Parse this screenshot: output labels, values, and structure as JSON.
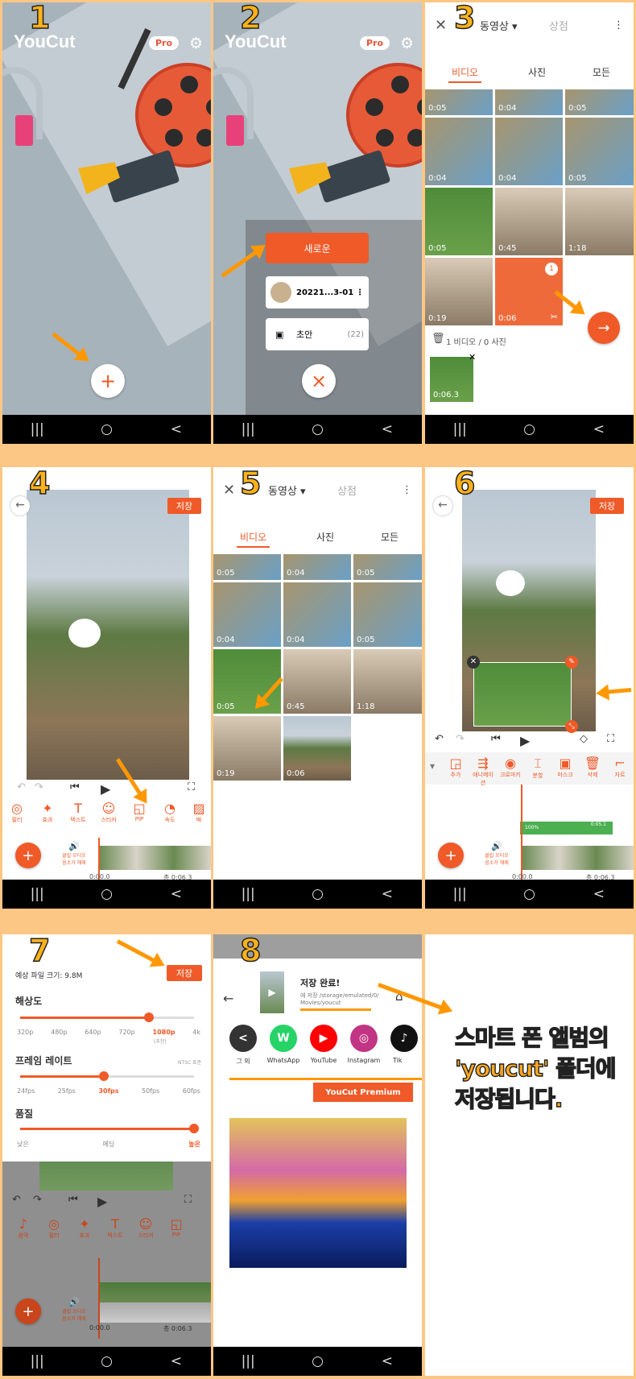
{
  "steps": [
    "1",
    "2",
    "3",
    "4",
    "5",
    "6",
    "7",
    "8"
  ],
  "home": {
    "logo": "YouCut",
    "pro": "Pro",
    "gear": "⚙",
    "plus": "+",
    "close": "×"
  },
  "menu2": {
    "new": "새로운",
    "project": "20221...3-01",
    "drafts": "초안",
    "drafts_count": "(22)"
  },
  "picker": {
    "type": "동영상",
    "store": "상점",
    "tabs": [
      "비디오",
      "사진",
      "모든"
    ],
    "durations": [
      "0:05",
      "0:04",
      "0:05",
      "0:04",
      "0:04",
      "0:05",
      "0:05",
      "0:45",
      "1:18",
      "0:19",
      "0:06"
    ],
    "badge": "1",
    "selected": "1 비디오 / 0 사진",
    "sel_dur": "0:06.3"
  },
  "editor": {
    "save": "저장",
    "tools4": [
      "필터",
      "효과",
      "텍스트",
      "스티커",
      "PIP",
      "속도",
      "배"
    ],
    "audio": "클립 오디오\n음소거 해제",
    "t0": "0:00.0",
    "total": "총 0:06.3",
    "tools6": [
      "추가",
      "애니메이션",
      "크로마키",
      "분할",
      "마스크",
      "삭제",
      "자르"
    ],
    "pip_dur": "0:05.1",
    "pip_pct": "100%"
  },
  "export": {
    "size": "예상 파일 크기: 9.8M",
    "res_label": "해상도",
    "res": [
      "320p",
      "480p",
      "640p",
      "720p",
      "1080p",
      "4k"
    ],
    "res_sel": "1080p",
    "res_note": "(추천)",
    "fps_label": "프레임 레이트",
    "ntsc": "NTSC 표준",
    "fps": [
      "24fps",
      "25fps",
      "30fps",
      "50fps",
      "60fps"
    ],
    "fps_sel": "30fps",
    "q_label": "품질",
    "q": [
      "낮은",
      "메딩",
      "높은"
    ],
    "q_sel": "높은",
    "tools7": [
      "음악",
      "필터",
      "효과",
      "텍스트",
      "스티커",
      "PIP"
    ]
  },
  "saved": {
    "title": "저장 완료!",
    "path1": "에 저장 /storage/emulated/0/",
    "path2": "Movies/youcut",
    "shares": [
      {
        "label": "그 외",
        "color": "#333333",
        "glyph": "<"
      },
      {
        "label": "WhatsApp",
        "color": "#25d366",
        "glyph": "W"
      },
      {
        "label": "YouTube",
        "color": "#ff0000",
        "glyph": "▶"
      },
      {
        "label": "Instagram",
        "color": "#c13584",
        "glyph": "◎"
      },
      {
        "label": "Tik",
        "color": "#111111",
        "glyph": "♪"
      }
    ],
    "premium": "YouCut Premium"
  },
  "note": "스마트 폰 앨범의\n'youcut' 폴더에\n저장됩니다.",
  "nav": [
    "|||",
    "○",
    "<"
  ]
}
